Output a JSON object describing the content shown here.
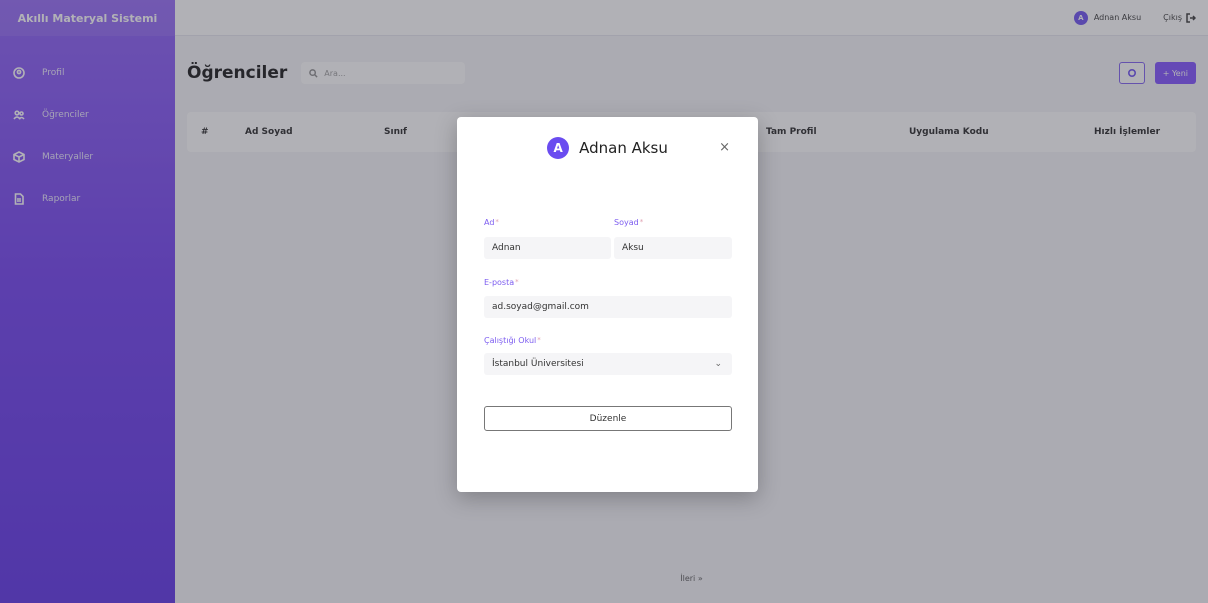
{
  "app": {
    "brand": "Akıllı Materyal Sistemi"
  },
  "sidebar": {
    "items": [
      {
        "label": "Profil",
        "icon": "profile-icon"
      },
      {
        "label": "Öğrenciler",
        "icon": "users-icon"
      },
      {
        "label": "Materyaller",
        "icon": "box-icon"
      },
      {
        "label": "Raporlar",
        "icon": "report-icon"
      }
    ]
  },
  "topbar": {
    "user_initial": "A",
    "user_name": "Adnan Aksu",
    "logout_label": "Çıkış"
  },
  "page": {
    "title": "Öğrenciler",
    "search_placeholder": "Ara...",
    "new_label": "+ Yeni",
    "columns": [
      "#",
      "Ad Soyad",
      "Sınıf",
      "Tam Profil",
      "Uygulama Kodu",
      "Hızlı İşlemler"
    ],
    "pager_next": "İleri »"
  },
  "modal": {
    "initial": "A",
    "title": "Adnan Aksu",
    "close": "×",
    "first_name_label": "Ad",
    "first_name_value": "Adnan",
    "last_name_label": "Soyad",
    "last_name_value": "Aksu",
    "email_label": "E-posta",
    "email_value": "ad.soyad@gmail.com",
    "school_label": "Çalıştığı Okul",
    "school_value": "İstanbul Üniversitesi",
    "required_mark": "*",
    "submit_label": "Düzenle"
  },
  "colors": {
    "accent": "#7c4dff",
    "sidebar_top": "#8a5cf6",
    "sidebar_bottom": "#5a2de6"
  }
}
